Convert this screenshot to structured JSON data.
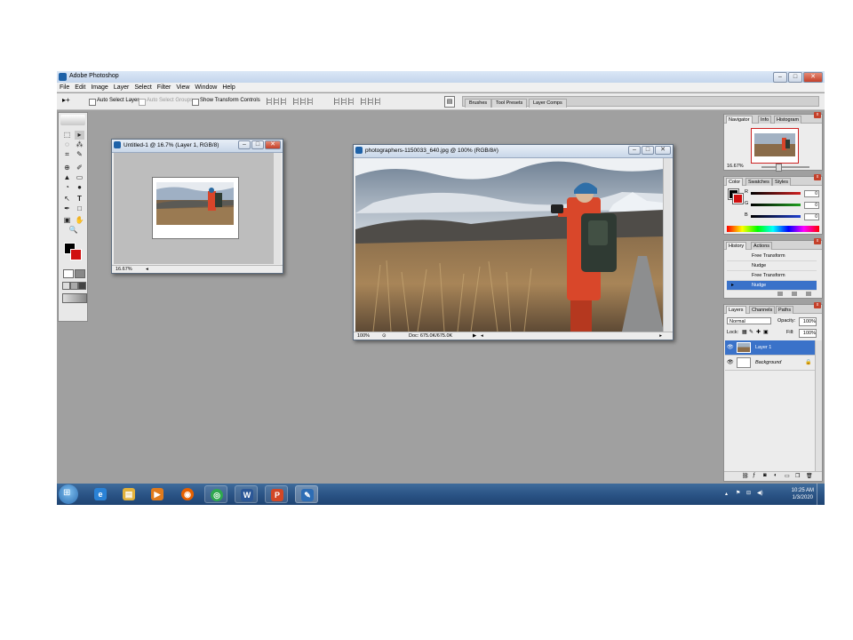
{
  "app": {
    "title": "Adobe Photoshop",
    "window_buttons": [
      "–",
      "□",
      "✕"
    ]
  },
  "menu": [
    "File",
    "Edit",
    "Image",
    "Layer",
    "Select",
    "Filter",
    "View",
    "Window",
    "Help"
  ],
  "options_bar": {
    "tool_glyph": "▸+",
    "auto_select_layer": "Auto Select Layer",
    "auto_select_groups": "Auto Select Groups",
    "show_transform_controls": "Show Transform Controls",
    "well_tabs": [
      "Brushes",
      "Tool Presets",
      "Layer Comps"
    ]
  },
  "toolbox": {
    "tools": [
      "⬚",
      "▸",
      "◌",
      "⁂",
      "⌗",
      "✎",
      "⊕",
      "✐",
      "▲",
      "▭",
      "◔",
      "●",
      "↖",
      "T",
      "✒",
      "□",
      "▣",
      "✋",
      "🔍"
    ]
  },
  "documents": [
    {
      "title": "Untitled-1 @ 16.7% (Layer 1, RGB/8)",
      "zoom": "16.67%"
    },
    {
      "title": "photographers-1150033_640.jpg @ 100% (RGB/8#)",
      "zoom": "100%",
      "doc_info": "Doc: 675.0K/675.0K"
    }
  ],
  "navigator": {
    "tabs": [
      "Navigator",
      "Info",
      "Histogram"
    ],
    "zoom": "16.67%"
  },
  "color_panel": {
    "tabs": [
      "Color",
      "Swatches",
      "Styles"
    ],
    "channels": [
      {
        "label": "R",
        "value": "0",
        "color": "#d02020"
      },
      {
        "label": "G",
        "value": "0",
        "color": "#20a020"
      },
      {
        "label": "B",
        "value": "0",
        "color": "#2040d0"
      }
    ]
  },
  "history_panel": {
    "tabs": [
      "History",
      "Actions"
    ],
    "items": [
      "Free Transform",
      "Nudge",
      "Free Transform",
      "Nudge"
    ],
    "selected_index": 3
  },
  "layers_panel": {
    "tabs": [
      "Layers",
      "Channels",
      "Paths"
    ],
    "blend_mode": "Normal",
    "opacity_label": "Opacity:",
    "opacity": "100%",
    "lock_label": "Lock:",
    "fill_label": "Fill:",
    "fill": "100%",
    "layers": [
      {
        "name": "Layer 1",
        "selected": true
      },
      {
        "name": "Background",
        "selected": false
      }
    ]
  },
  "taskbar": {
    "apps": [
      {
        "name": "start-orb",
        "glyph": "⊞",
        "color": "#3d8ad6"
      },
      {
        "name": "internet-explorer",
        "glyph": "e",
        "color": "#2a82d6"
      },
      {
        "name": "file-explorer",
        "glyph": "▤",
        "color": "#e3b23c"
      },
      {
        "name": "media-player",
        "glyph": "▶",
        "color": "#e07b1d"
      },
      {
        "name": "firefox",
        "glyph": "◉",
        "color": "#e66000"
      },
      {
        "name": "chrome",
        "glyph": "◎",
        "color": "#2fa84f"
      },
      {
        "name": "word",
        "glyph": "W",
        "color": "#2b5797"
      },
      {
        "name": "powerpoint",
        "glyph": "P",
        "color": "#d24726"
      },
      {
        "name": "photoshop",
        "glyph": "✎",
        "color": "#2d6db5"
      }
    ],
    "time": "10:25 AM",
    "date": "1/3/2020"
  },
  "colors": {
    "workspace": "#a0a0a0",
    "selection": "#3a72c9",
    "foreground_swatch": "#000000",
    "background_swatch": "#d01010"
  }
}
